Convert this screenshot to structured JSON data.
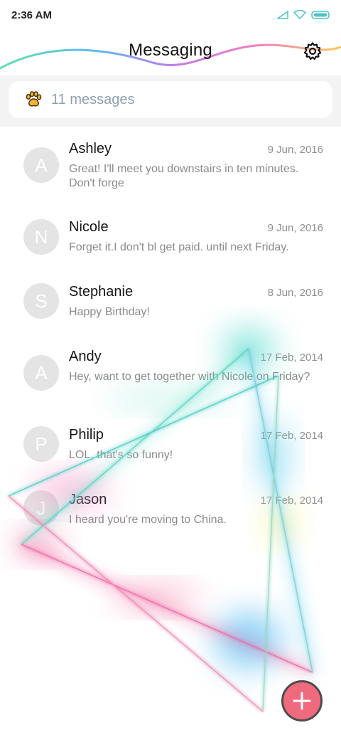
{
  "status_bar": {
    "time": "2:36 AM",
    "icons": [
      "signal-icon",
      "wifi-icon",
      "battery-icon"
    ]
  },
  "header": {
    "title": "Messaging",
    "settings_icon": "gear-icon"
  },
  "summary": {
    "icon": "paw-icon",
    "text": "11 messages"
  },
  "messages": [
    {
      "initial": "A",
      "name": "Ashley",
      "date": "9 Jun, 2016",
      "preview": "Great! I'll meet you downstairs in ten minutes. Don't forge"
    },
    {
      "initial": "N",
      "name": "Nicole",
      "date": "9 Jun, 2016",
      "preview": "Forget it.I don't bl get paid. until next Friday."
    },
    {
      "initial": "S",
      "name": "Stephanie",
      "date": "8 Jun, 2016",
      "preview": "Happy Birthday!"
    },
    {
      "initial": "A",
      "name": "Andy",
      "date": "17 Feb, 2014",
      "preview": "Hey, want to get together with Nicole on Friday?"
    },
    {
      "initial": "P",
      "name": "Philip",
      "date": "17 Feb, 2014",
      "preview": "LOL, that's so funny!"
    },
    {
      "initial": "J",
      "name": "Jason",
      "date": "17 Feb, 2014",
      "preview": "I heard you're moving to China."
    }
  ],
  "fab": {
    "icon": "plus-icon"
  },
  "colors": {
    "fab": "#f06a7e",
    "summary_text": "#8da0b2",
    "avatar_bg": "#e4e4e4",
    "wave": [
      "#5ee0b0",
      "#5fb8f5",
      "#c07af0",
      "#f080c0",
      "#f8c85a"
    ]
  }
}
